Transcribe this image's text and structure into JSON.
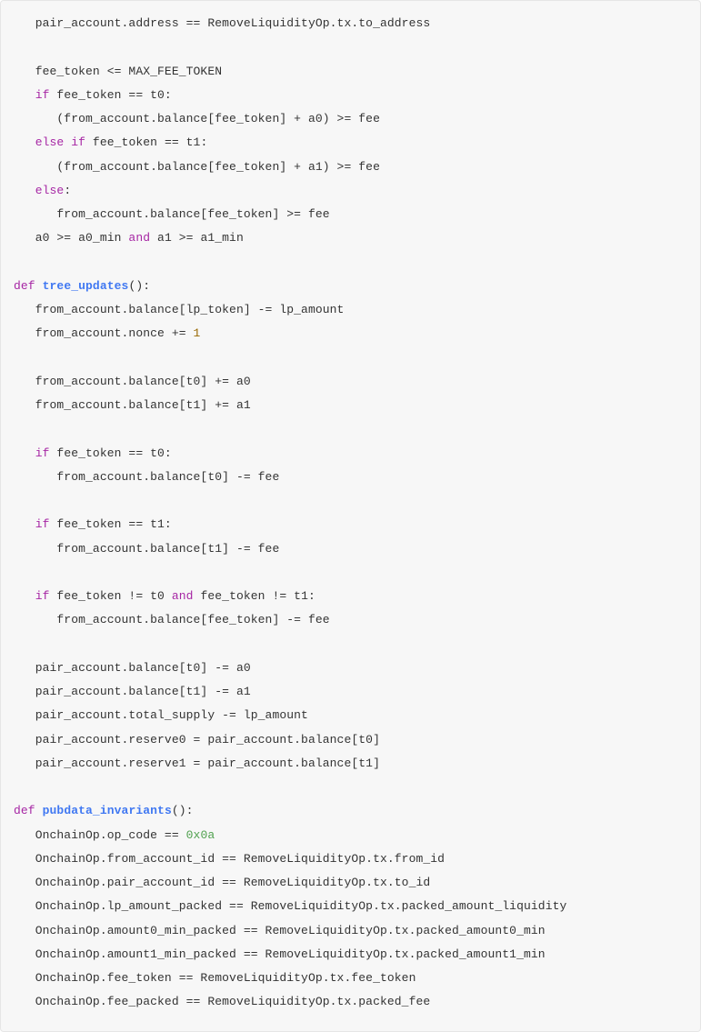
{
  "code": {
    "l01_a": "   pair_account.address == RemoveLiquidityOp.tx.to_address",
    "l02_blank": "",
    "l03_a": "   fee_token <= MAX_FEE_TOKEN",
    "l04_kw_if": "   if",
    "l04_rest": " fee_token == t0:",
    "l05_a": "      (from_account.balance[fee_token] + a0) >= fee",
    "l06_kw_else": "   else",
    "l06_kw_if": " if",
    "l06_rest": " fee_token == t1:",
    "l07_a": "      (from_account.balance[fee_token] + a1) >= fee",
    "l08_kw_else": "   else",
    "l08_colon": ":",
    "l09_a": "      from_account.balance[fee_token] >= fee",
    "l10_a": "   a0 >= a0_min ",
    "l10_kw_and": "and",
    "l10_b": " a1 >= a1_min",
    "l11_blank": "",
    "l12_kw_def": "def",
    "l12_sp": " ",
    "l12_fn": "tree_updates",
    "l12_paren": "():",
    "l13_a": "   from_account.balance[lp_token] -= lp_amount",
    "l14_a": "   from_account.nonce += ",
    "l14_num": "1",
    "l15_blank": "",
    "l16_a": "   from_account.balance[t0] += a0",
    "l17_a": "   from_account.balance[t1] += a1",
    "l18_blank": "",
    "l19_kw_if": "   if",
    "l19_rest": " fee_token == t0:",
    "l20_a": "      from_account.balance[t0] -= fee",
    "l21_blank": "",
    "l22_kw_if": "   if",
    "l22_rest": " fee_token == t1:",
    "l23_a": "      from_account.balance[t1] -= fee",
    "l24_blank": "",
    "l25_kw_if": "   if",
    "l25_mid1": " fee_token != t0 ",
    "l25_kw_and": "and",
    "l25_mid2": " fee_token != t1:",
    "l26_a": "      from_account.balance[fee_token] -= fee",
    "l27_blank": "",
    "l28_a": "   pair_account.balance[t0] -= a0",
    "l29_a": "   pair_account.balance[t1] -= a1",
    "l30_a": "   pair_account.total_supply -= lp_amount",
    "l31_a": "   pair_account.reserve0 = pair_account.balance[t0]",
    "l32_a": "   pair_account.reserve1 = pair_account.balance[t1]",
    "l33_blank": "",
    "l34_kw_def": "def",
    "l34_sp": " ",
    "l34_fn": "pubdata_invariants",
    "l34_paren": "():",
    "l35_a": "   OnchainOp.op_code == ",
    "l35_hex": "0x0a",
    "l36_a": "   OnchainOp.from_account_id == RemoveLiquidityOp.tx.from_id",
    "l37_a": "   OnchainOp.pair_account_id == RemoveLiquidityOp.tx.to_id",
    "l38_a": "   OnchainOp.lp_amount_packed == RemoveLiquidityOp.tx.packed_amount_liquidity",
    "l39_a": "   OnchainOp.amount0_min_packed == RemoveLiquidityOp.tx.packed_amount0_min",
    "l40_a": "   OnchainOp.amount1_min_packed == RemoveLiquidityOp.tx.packed_amount1_min",
    "l41_a": "   OnchainOp.fee_token == RemoveLiquidityOp.tx.fee_token",
    "l42_a": "   OnchainOp.fee_packed == RemoveLiquidityOp.tx.packed_fee"
  }
}
